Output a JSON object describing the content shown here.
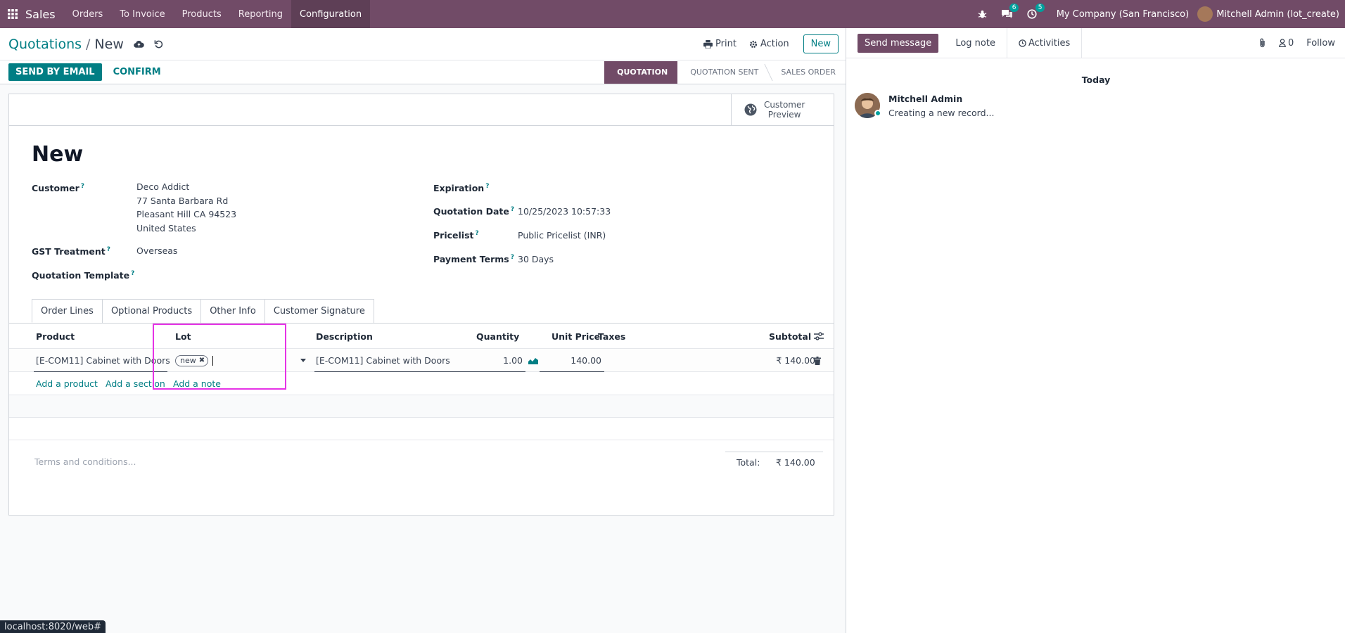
{
  "navbar": {
    "app_name": "Sales",
    "menu": [
      "Orders",
      "To Invoice",
      "Products",
      "Reporting",
      "Configuration"
    ],
    "messages_count": "6",
    "activities_count": "5",
    "company": "My Company (San Francisco)",
    "user": "Mitchell Admin (lot_create)"
  },
  "control_panel": {
    "breadcrumb_parent": "Quotations",
    "breadcrumb_sep": "/",
    "breadcrumb_current": "New",
    "print_label": "Print",
    "action_label": "Action",
    "new_label": "New"
  },
  "statusbar": {
    "send_email_label": "SEND BY EMAIL",
    "confirm_label": "CONFIRM",
    "stages": [
      "QUOTATION",
      "QUOTATION SENT",
      "SALES ORDER"
    ]
  },
  "sheet": {
    "customer_preview": [
      "Customer",
      "Preview"
    ],
    "title": "New",
    "left_fields": {
      "customer_label": "Customer",
      "customer_lines": [
        "Deco Addict",
        "77 Santa Barbara Rd",
        "Pleasant Hill CA 94523",
        "United States"
      ],
      "gst_label": "GST Treatment",
      "gst_value": "Overseas",
      "template_label": "Quotation Template"
    },
    "right_fields": {
      "expiration_label": "Expiration",
      "quotation_date_label": "Quotation Date",
      "quotation_date_value": "10/25/2023 10:57:33",
      "pricelist_label": "Pricelist",
      "pricelist_value": "Public Pricelist (INR)",
      "payment_terms_label": "Payment Terms",
      "payment_terms_value": "30 Days"
    },
    "tabs": [
      "Order Lines",
      "Optional Products",
      "Other Info",
      "Customer Signature"
    ],
    "table": {
      "columns": [
        "Product",
        "Lot",
        "Description",
        "Quantity",
        "Unit Price",
        "Taxes",
        "Subtotal"
      ],
      "row": {
        "product": "[E-COM11] Cabinet with Doors",
        "lot_tag": "new",
        "description": "[E-COM11] Cabinet with Doors",
        "quantity": "1.00",
        "unit_price": "140.00",
        "taxes": "",
        "subtotal": "₹ 140.00"
      },
      "add_product": "Add a product",
      "add_section": "Add a section",
      "add_note": "Add a note"
    },
    "terms_placeholder": "Terms and conditions...",
    "total_label": "Total:",
    "total_value": "₹ 140.00"
  },
  "chatter": {
    "send_message": "Send message",
    "log_note": "Log note",
    "activities": "Activities",
    "followers_count": "0",
    "follow": "Follow",
    "date_separator": "Today",
    "message_author": "Mitchell Admin",
    "message_body": "Creating a new record..."
  },
  "status_url": "localhost:8020/web#",
  "colors": {
    "brand": "#714b67",
    "accent": "#017e84",
    "highlight": "#e633e6"
  }
}
